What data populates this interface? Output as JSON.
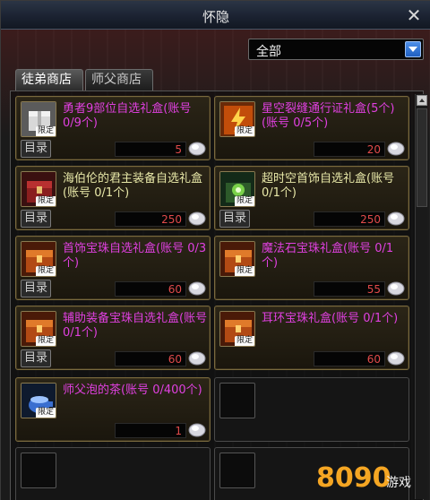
{
  "window": {
    "title": "怀隐"
  },
  "filter": {
    "selected": "全部"
  },
  "tabs": [
    {
      "label": "徒弟商店",
      "active": true
    },
    {
      "label": "师父商店",
      "active": false
    }
  ],
  "common": {
    "catalog_label": "目录",
    "limited_tag": "限定"
  },
  "items": [
    {
      "name": "勇者9部位自选礼盒(账号 0/9个)",
      "price": "5",
      "name_color": "#e040e0",
      "icon": "gift-box-icon"
    },
    {
      "name": "星空裂缝通行证礼盒(5个)(账号 0/5个)",
      "price": "20",
      "name_color": "#e040e0",
      "icon": "lightning-box-icon"
    },
    {
      "name": "海伯伦的君主装备自选礼盒(账号 0/1个)",
      "price": "250",
      "name_color": "#e8e8a8",
      "icon": "chest-icon"
    },
    {
      "name": "超时空首饰自选礼盒(账号 0/1个)",
      "price": "250",
      "name_color": "#e8e8a8",
      "icon": "jewel-box-icon"
    },
    {
      "name": "首饰宝珠自选礼盒(账号 0/3个)",
      "price": "60",
      "name_color": "#e040e0",
      "icon": "orb-chest-icon"
    },
    {
      "name": "魔法石宝珠礼盒(账号 0/1个)",
      "price": "55",
      "name_color": "#e040e0",
      "icon": "orb-chest-icon"
    },
    {
      "name": "辅助装备宝珠自选礼盒(账号 0/1个)",
      "price": "60",
      "name_color": "#e040e0",
      "icon": "orb-chest-icon"
    },
    {
      "name": "耳环宝珠礼盒(账号 0/1个)",
      "price": "60",
      "name_color": "#e040e0",
      "icon": "orb-chest-icon"
    },
    {
      "name": "师父泡的茶(账号 0/400个)",
      "price": "1",
      "name_color": "#e040e0",
      "icon": "tea-icon"
    }
  ],
  "watermark": {
    "text": "8090游戏"
  },
  "colors": {
    "price": "#e04a4a",
    "magenta": "#e040e0",
    "cream": "#e8e8a8"
  }
}
